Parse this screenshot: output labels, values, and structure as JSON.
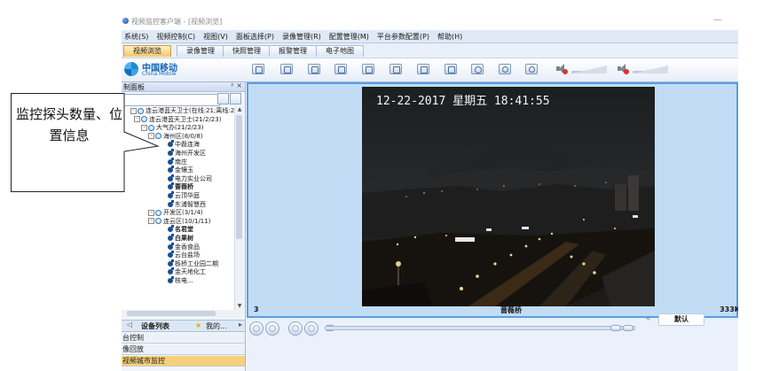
{
  "window": {
    "title": "视频监控客户端 - [视频浏览]"
  },
  "menu": [
    "系统(S)",
    "视频控制(C)",
    "视图(V)",
    "面板选择(P)",
    "录像管理(R)",
    "配置管理(M)",
    "平台参数配置(P)",
    "帮助(H)"
  ],
  "tabs": [
    {
      "label": "视频浏览",
      "active": true
    },
    {
      "label": "录像管理",
      "active": false
    },
    {
      "label": "快照管理",
      "active": false
    },
    {
      "label": "报警管理",
      "active": false
    },
    {
      "label": "电子地图",
      "active": false
    }
  ],
  "logo": {
    "cn": "中国移动",
    "en": "China Mobile"
  },
  "panel": {
    "title": "制面板",
    "controls": "ᵖ ×",
    "tabs": {
      "devlist": "设备列表",
      "mine": "我的..."
    },
    "items": [
      "台控制",
      "像回放",
      "视频城市监控"
    ]
  },
  "tree": [
    {
      "label": "连云港蓝天卫士(在线:21;离线:2",
      "level": 0,
      "kind": "group",
      "bold": false
    },
    {
      "label": "连云港蓝天卫士(21/2/23)",
      "level": 1,
      "kind": "group",
      "bold": false
    },
    {
      "label": "大气办(21/2/23)",
      "level": 2,
      "kind": "group",
      "bold": false
    },
    {
      "label": "海州区(8/0/8)",
      "level": 3,
      "kind": "group",
      "bold": false
    },
    {
      "label": "中磊连海",
      "level": 4,
      "kind": "camera",
      "bold": false
    },
    {
      "label": "海州开发区",
      "level": 4,
      "kind": "camera",
      "bold": false
    },
    {
      "label": "南庄",
      "level": 4,
      "kind": "camera",
      "bold": false
    },
    {
      "label": "金镶玉",
      "level": 4,
      "kind": "camera",
      "bold": false
    },
    {
      "label": "电力实业公司",
      "level": 4,
      "kind": "camera",
      "bold": false
    },
    {
      "label": "蔷薇桥",
      "level": 4,
      "kind": "camera",
      "bold": true
    },
    {
      "label": "云顶华庭",
      "level": 4,
      "kind": "camera",
      "bold": false
    },
    {
      "label": "东浦智慧西",
      "level": 4,
      "kind": "camera",
      "bold": false
    },
    {
      "label": "开发区(3/1/4)",
      "level": 3,
      "kind": "group",
      "bold": false
    },
    {
      "label": "连云区(10/1/11)",
      "level": 3,
      "kind": "group",
      "bold": false
    },
    {
      "label": "名君堂",
      "level": 4,
      "kind": "camera",
      "bold": true
    },
    {
      "label": "白果树",
      "level": 4,
      "kind": "camera",
      "bold": true
    },
    {
      "label": "金香食品",
      "level": 4,
      "kind": "camera",
      "bold": false
    },
    {
      "label": "云台盐场",
      "level": 4,
      "kind": "camera",
      "bold": false
    },
    {
      "label": "板桥工业园二期",
      "level": 4,
      "kind": "camera",
      "bold": false
    },
    {
      "label": "金天地化工",
      "level": 4,
      "kind": "camera",
      "bold": false
    },
    {
      "label": "核电...",
      "level": 4,
      "kind": "camera",
      "bold": false
    }
  ],
  "video": {
    "osd": "12-22-2017  星期五  18:41:55",
    "channel": "3",
    "camera_name": "蔷薇桥",
    "right_label": "333K"
  },
  "playback": {
    "default_label": "默认",
    "small_label": "<"
  },
  "callout": {
    "text": "监控探头数量、位置信息"
  },
  "toolbar_icons": [
    "single-view-icon",
    "split-4-icon",
    "split-9-icon",
    "split-16-icon",
    "fullscreen-icon",
    "record-icon",
    "snapshot-icon",
    "refresh-icon",
    "zoom-in-icon",
    "zoom-out-icon",
    "speaker-icon",
    "mic-icon"
  ]
}
